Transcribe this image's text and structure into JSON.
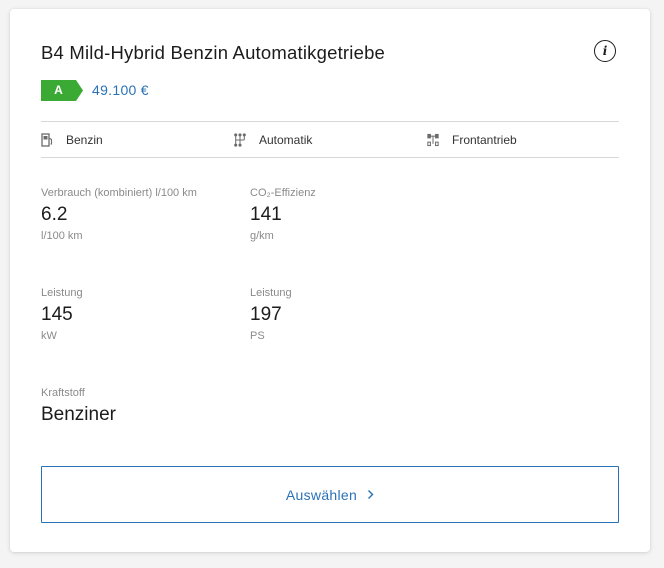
{
  "card": {
    "title": "B4 Mild-Hybrid Benzin Automatikgetriebe",
    "info_icon": "info-icon",
    "energy_class": "A",
    "energy_class_color": "#3aaa35",
    "price": "49.100 €",
    "accent_color": "#2a72b8"
  },
  "features": [
    {
      "icon": "fuel-pump-icon",
      "label": "Benzin"
    },
    {
      "icon": "gear-shift-icon",
      "label": "Automatik"
    },
    {
      "icon": "drivetrain-icon",
      "label": "Frontantrieb"
    }
  ],
  "specs": {
    "consumption": {
      "label": "Verbrauch (kombiniert) l/100 km",
      "value": "6.2",
      "unit": "l/100 km"
    },
    "co2": {
      "label": "CO₂-Effizienz",
      "value": "141",
      "unit": "g/km"
    },
    "power_kw": {
      "label": "Leistung",
      "value": "145",
      "unit": "kW"
    },
    "power_ps": {
      "label": "Leistung",
      "value": "197",
      "unit": "PS"
    },
    "fuel": {
      "label": "Kraftstoff",
      "value": "Benziner"
    }
  },
  "action": {
    "select_label": "Auswählen",
    "chevron_icon": "chevron-right-icon"
  }
}
